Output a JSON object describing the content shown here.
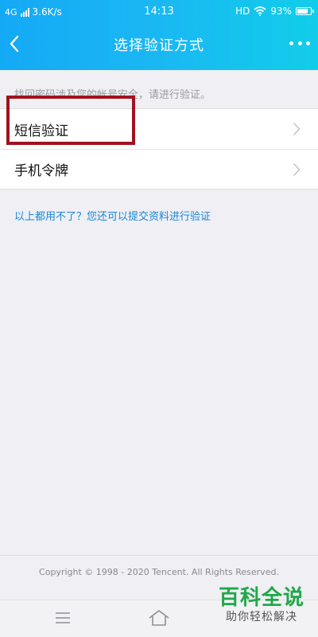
{
  "status_bar": {
    "network": "4G",
    "speed": "3.6K/s",
    "time": "14:13",
    "hd": "HD",
    "battery": "93%",
    "battery_level": 0.93
  },
  "nav": {
    "title": "选择验证方式",
    "back_icon": "chevron-left-icon",
    "more_icon": "more-dots-icon"
  },
  "content": {
    "hint": "找回密码涉及您的帐号安全，请进行验证。",
    "options": [
      {
        "label": "短信验证",
        "icon": "chevron-right-icon"
      },
      {
        "label": "手机令牌",
        "icon": "chevron-right-icon"
      }
    ],
    "alt_link": "以上都用不了？您还可以提交资料进行验证",
    "highlight_color": "#a0121f"
  },
  "footer": {
    "copyright": "Copyright © 1998 - 2020 Tencent. All Rights Reserved."
  },
  "bottom_nav": {
    "menu_icon": "menu-icon",
    "home_icon": "home-icon"
  },
  "watermark": {
    "title": "百科全说",
    "subtitle": "助你轻松解决"
  },
  "colors": {
    "header_start": "#14a9f5",
    "header_end": "#11cde9",
    "link": "#1a86d8",
    "background": "#efeff4"
  }
}
